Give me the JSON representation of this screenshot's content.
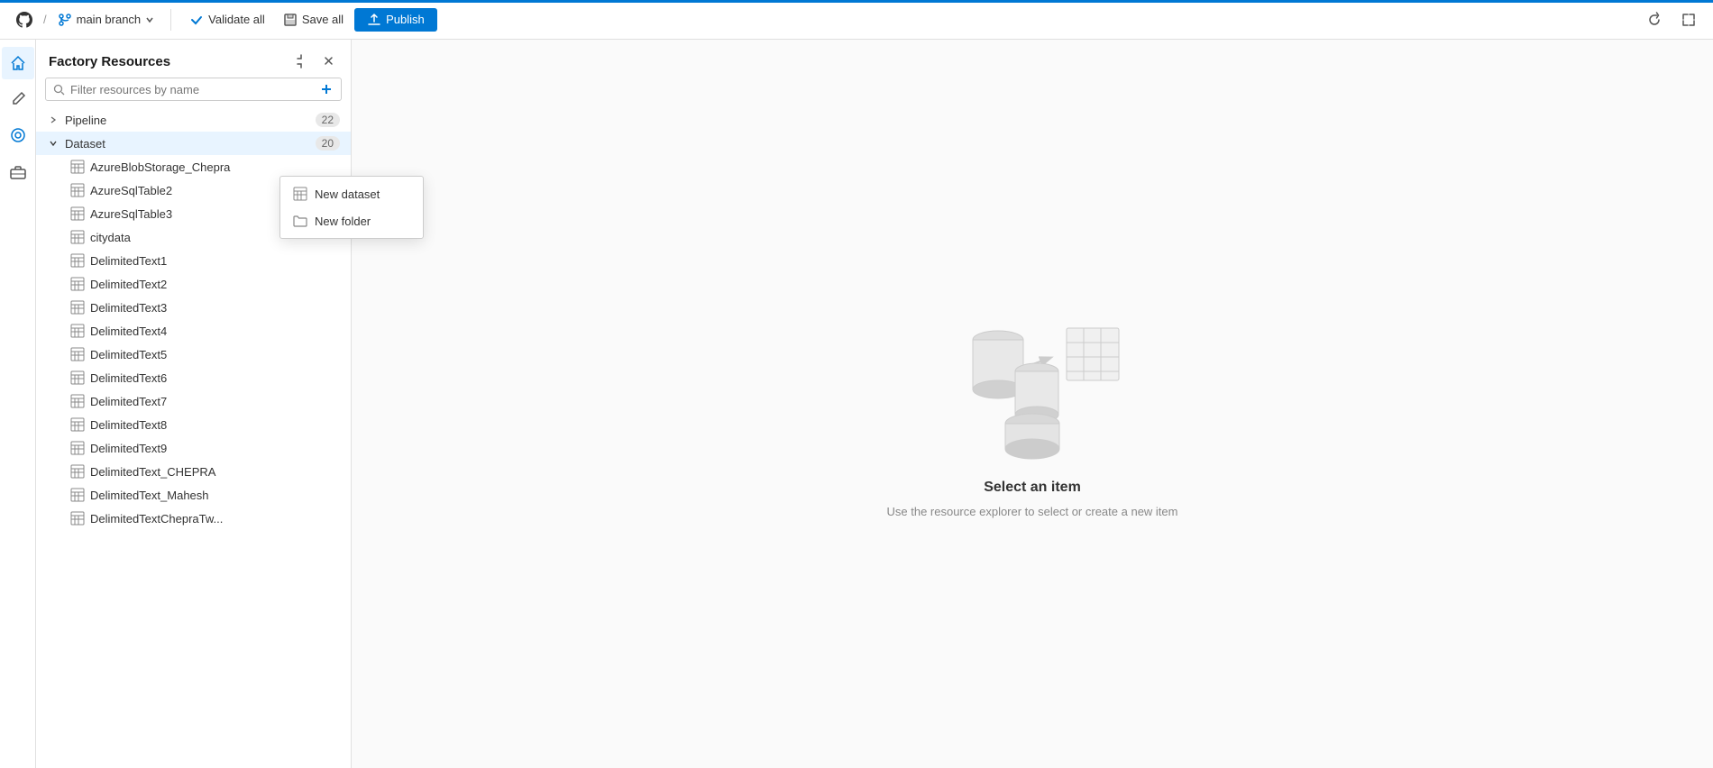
{
  "topbar": {
    "github_icon": "github-icon",
    "branch_label": "main branch",
    "validate_all": "Validate all",
    "save_all": "Save all",
    "publish": "Publish",
    "refresh_icon": "refresh-icon",
    "expand_icon": "expand-icon"
  },
  "sidebar_icons": [
    {
      "name": "home-icon",
      "icon": "⌂",
      "active": true
    },
    {
      "name": "edit-icon",
      "icon": "✏",
      "active": false
    },
    {
      "name": "monitor-icon",
      "icon": "◎",
      "active": false
    },
    {
      "name": "briefcase-icon",
      "icon": "💼",
      "active": false
    }
  ],
  "resources_panel": {
    "title": "Factory Resources",
    "collapse_icon": "collapse-icon",
    "close_panel_icon": "close-panel-icon",
    "search_placeholder": "Filter resources by name",
    "add_icon": "add-icon"
  },
  "tree": {
    "pipeline": {
      "label": "Pipeline",
      "count": "22",
      "expanded": false
    },
    "dataset": {
      "label": "Dataset",
      "count": "20",
      "expanded": true
    },
    "items": [
      "AzureBlobStorage_Chepra",
      "AzureSqlTable2",
      "AzureSqlTable3",
      "citydata",
      "DelimitedText1",
      "DelimitedText2",
      "DelimitedText3",
      "DelimitedText4",
      "DelimitedText5",
      "DelimitedText6",
      "DelimitedText7",
      "DelimitedText8",
      "DelimitedText9",
      "DelimitedText_CHEPRA",
      "DelimitedText_Mahesh",
      "DelimitedTextChepraTw..."
    ]
  },
  "context_menu": {
    "new_dataset": "New dataset",
    "new_folder": "New folder"
  },
  "main_content": {
    "title": "Select an item",
    "subtitle": "Use the resource explorer to select or create a new item"
  }
}
